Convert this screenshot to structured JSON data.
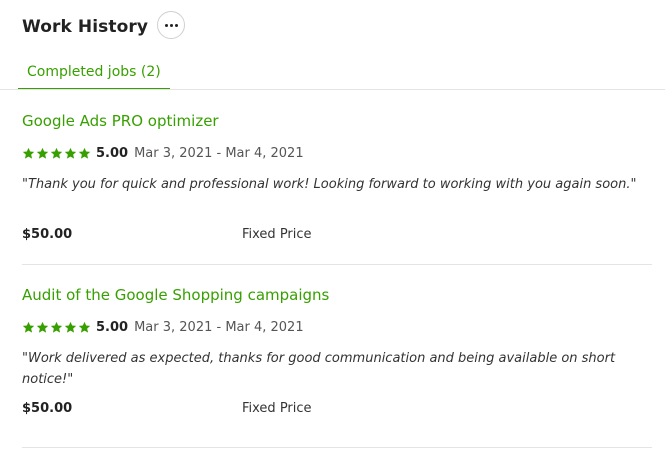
{
  "header": {
    "title": "Work History",
    "more_icon": "ellipsis-icon"
  },
  "tabs": [
    {
      "label": "Completed jobs (2)",
      "active": true
    }
  ],
  "accent_color": "#37a000",
  "jobs": [
    {
      "title": "Google Ads PRO optimizer",
      "rating": "5.00",
      "stars": 5,
      "dates": "Mar 3, 2021 - Mar 4, 2021",
      "review": "\"Thank you for quick and professional work! Looking forward to working with you again soon.\"",
      "price": "$50.00",
      "price_type": "Fixed Price"
    },
    {
      "title": "Audit of the Google Shopping campaigns",
      "rating": "5.00",
      "stars": 5,
      "dates": "Mar 3, 2021 - Mar 4, 2021",
      "review": "\"Work delivered as expected, thanks for good communication and being available on short notice!\"",
      "price": "$50.00",
      "price_type": "Fixed Price"
    }
  ]
}
